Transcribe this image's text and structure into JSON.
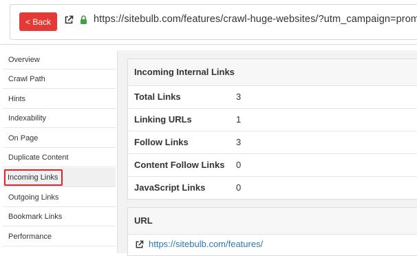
{
  "topbar": {
    "back_label": "< Back",
    "url": "https://sitebulb.com/features/crawl-huge-websites/?utm_campaign=promo"
  },
  "sidebar": {
    "items": [
      {
        "label": "Overview"
      },
      {
        "label": "Crawl Path"
      },
      {
        "label": "Hints"
      },
      {
        "label": "Indexability"
      },
      {
        "label": "On Page"
      },
      {
        "label": "Duplicate Content"
      },
      {
        "label": "Incoming Links",
        "active": true
      },
      {
        "label": "Outgoing Links"
      },
      {
        "label": "Bookmark Links"
      },
      {
        "label": "Performance"
      }
    ]
  },
  "incoming_panel": {
    "title": "Incoming Internal Links",
    "rows": [
      {
        "label": "Total Links",
        "value": "3"
      },
      {
        "label": "Linking URLs",
        "value": "1"
      },
      {
        "label": "Follow Links",
        "value": "3"
      },
      {
        "label": "Content Follow Links",
        "value": "0"
      },
      {
        "label": "JavaScript Links",
        "value": "0"
      }
    ]
  },
  "url_panel": {
    "title": "URL",
    "link": "https://sitebulb.com/features/"
  },
  "colors": {
    "back_button": "#e53935",
    "active_highlight": "#d9262c",
    "lock_green": "#43a047",
    "link": "#2a7ab0"
  },
  "icons": {
    "external": "external-link-icon",
    "lock": "lock-icon"
  }
}
